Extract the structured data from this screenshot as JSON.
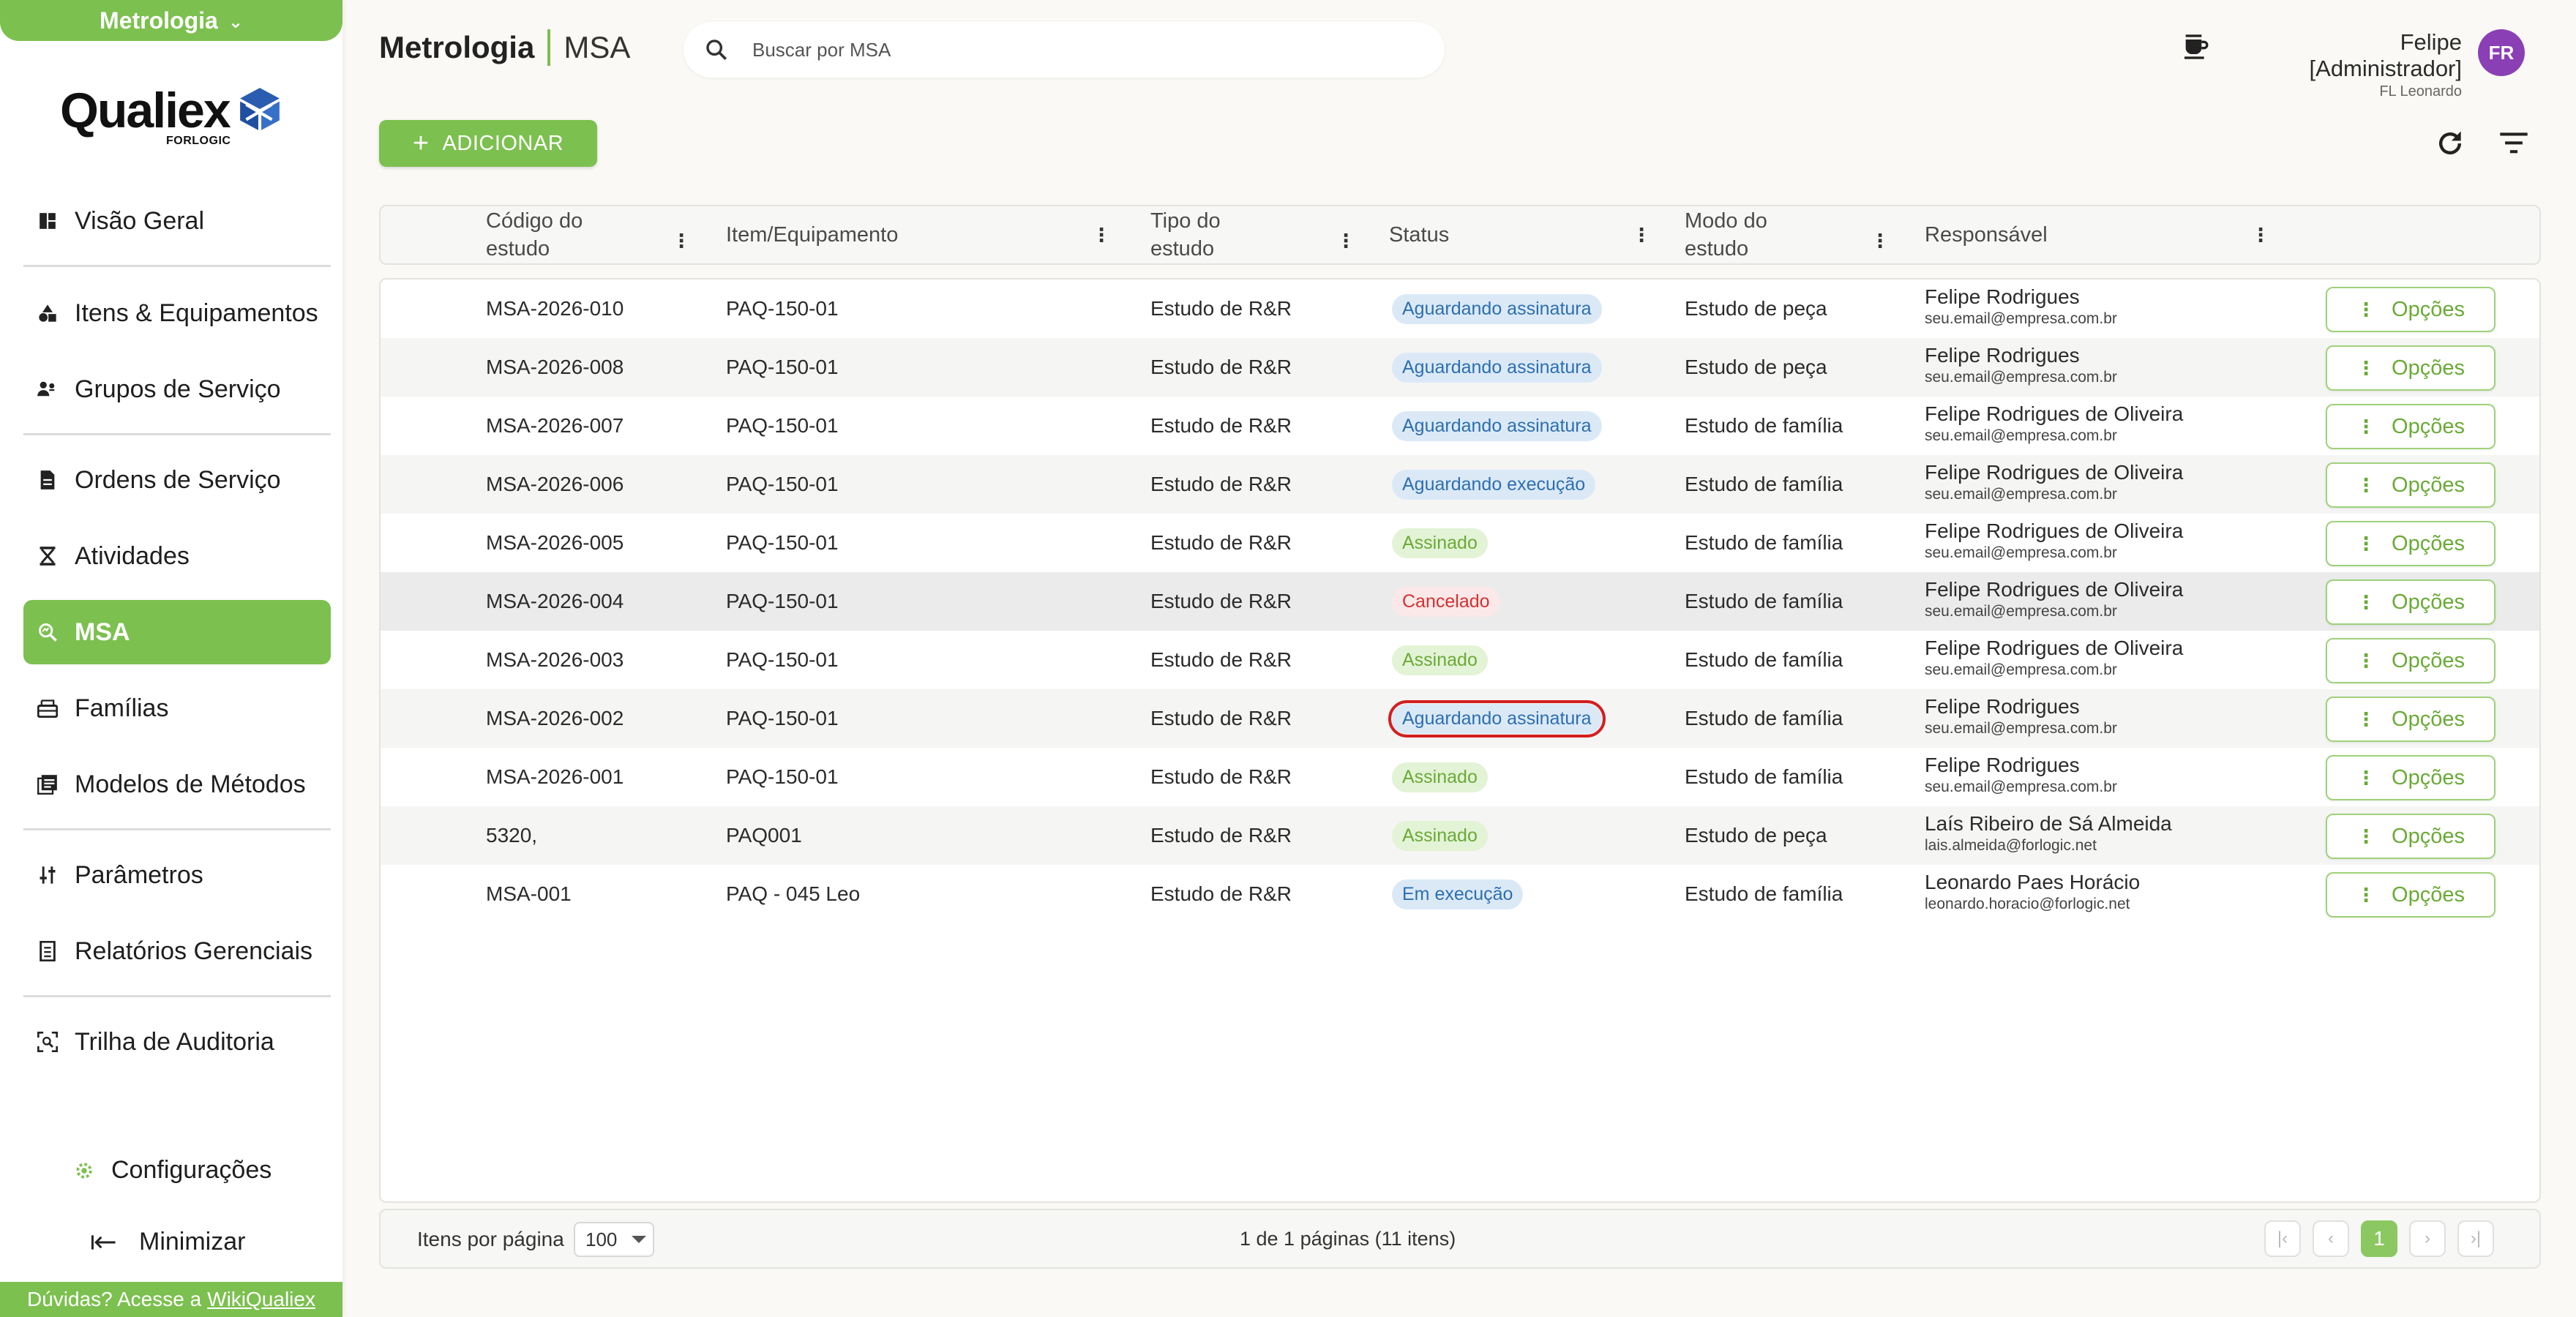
{
  "module": {
    "name": "Metrologia"
  },
  "logo": {
    "word": "Qualiex",
    "sub": "FORLOGIC"
  },
  "nav": {
    "items": [
      {
        "label": "Visão Geral",
        "icon": "dashboard-icon"
      },
      {
        "label": "Itens & Equipamentos",
        "icon": "shapes-icon"
      },
      {
        "label": "Grupos de Serviço",
        "icon": "people-icon"
      },
      {
        "label": "Ordens de Serviço",
        "icon": "document-icon"
      },
      {
        "label": "Atividades",
        "icon": "hourglass-icon"
      },
      {
        "label": "MSA",
        "icon": "magnify-icon",
        "active": true
      },
      {
        "label": "Famílias",
        "icon": "tray-icon"
      },
      {
        "label": "Modelos de Métodos",
        "icon": "library-icon"
      },
      {
        "label": "Parâmetros",
        "icon": "sliders-icon"
      },
      {
        "label": "Relatórios Gerenciais",
        "icon": "report-icon"
      },
      {
        "label": "Trilha de Auditoria",
        "icon": "audit-icon"
      }
    ],
    "settings_label": "Configurações",
    "minimize_label": "Minimizar"
  },
  "help": {
    "text": "Dúvidas? Acesse a",
    "link": "WikiQualiex"
  },
  "header": {
    "title_strong": "Metrologia",
    "title_light": "MSA",
    "search_placeholder": "Buscar por MSA",
    "user_name": "Felipe [Administrador]",
    "user_org": "FL Leonardo",
    "avatar_initials": "FR"
  },
  "toolbar": {
    "add_label": "ADICIONAR"
  },
  "table": {
    "columns": [
      {
        "label": "Código do estudo"
      },
      {
        "label": "Item/Equipamento"
      },
      {
        "label": "Tipo do estudo"
      },
      {
        "label": "Status"
      },
      {
        "label": "Modo do estudo"
      },
      {
        "label": "Responsável"
      }
    ],
    "options_label": "Opções",
    "rows": [
      {
        "code": "MSA-2026-010",
        "item": "PAQ-150-01",
        "type": "Estudo de R&R",
        "status": "Aguardando assinatura",
        "status_color": "blue",
        "mode": "Estudo de peça",
        "resp": "Felipe Rodrigues",
        "email": "seu.email@empresa.com.br"
      },
      {
        "code": "MSA-2026-008",
        "item": "PAQ-150-01",
        "type": "Estudo de R&R",
        "status": "Aguardando assinatura",
        "status_color": "blue",
        "mode": "Estudo de peça",
        "resp": "Felipe Rodrigues",
        "email": "seu.email@empresa.com.br"
      },
      {
        "code": "MSA-2026-007",
        "item": "PAQ-150-01",
        "type": "Estudo de R&R",
        "status": "Aguardando assinatura",
        "status_color": "blue",
        "mode": "Estudo de família",
        "resp": "Felipe Rodrigues de Oliveira",
        "email": "seu.email@empresa.com.br"
      },
      {
        "code": "MSA-2026-006",
        "item": "PAQ-150-01",
        "type": "Estudo de R&R",
        "status": "Aguardando execução",
        "status_color": "blue",
        "mode": "Estudo de família",
        "resp": "Felipe Rodrigues de Oliveira",
        "email": "seu.email@empresa.com.br"
      },
      {
        "code": "MSA-2026-005",
        "item": "PAQ-150-01",
        "type": "Estudo de R&R",
        "status": "Assinado",
        "status_color": "green",
        "mode": "Estudo de família",
        "resp": "Felipe Rodrigues de Oliveira",
        "email": "seu.email@empresa.com.br"
      },
      {
        "code": "MSA-2026-004",
        "item": "PAQ-150-01",
        "type": "Estudo de R&R",
        "status": "Cancelado",
        "status_color": "red",
        "mode": "Estudo de família",
        "resp": "Felipe Rodrigues de Oliveira",
        "email": "seu.email@empresa.com.br"
      },
      {
        "code": "MSA-2026-003",
        "item": "PAQ-150-01",
        "type": "Estudo de R&R",
        "status": "Assinado",
        "status_color": "green",
        "mode": "Estudo de família",
        "resp": "Felipe Rodrigues de Oliveira",
        "email": "seu.email@empresa.com.br"
      },
      {
        "code": "MSA-2026-002",
        "item": "PAQ-150-01",
        "type": "Estudo de R&R",
        "status": "Aguardando assinatura",
        "status_color": "blue",
        "mode": "Estudo de família",
        "resp": "Felipe Rodrigues",
        "email": "seu.email@empresa.com.br"
      },
      {
        "code": "MSA-2026-001",
        "item": "PAQ-150-01",
        "type": "Estudo de R&R",
        "status": "Assinado",
        "status_color": "green",
        "mode": "Estudo de família",
        "resp": "Felipe Rodrigues",
        "email": "seu.email@empresa.com.br"
      },
      {
        "code": "5320,",
        "item": "PAQ001",
        "type": "Estudo de R&R",
        "status": "Assinado",
        "status_color": "green",
        "mode": "Estudo de peça",
        "resp": "Laís Ribeiro de Sá Almeida",
        "email": "lais.almeida@forlogic.net"
      },
      {
        "code": "MSA-001",
        "item": "PAQ - 045 Leo",
        "type": "Estudo de R&R",
        "status": "Em execução",
        "status_color": "blue",
        "mode": "Estudo de família",
        "resp": "Leonardo Paes Horácio",
        "email": "leonardo.horacio@forlogic.net"
      }
    ]
  },
  "footer": {
    "per_page_label": "Itens por página",
    "per_page_value": "100",
    "page_info": "1 de 1 páginas (11 itens)",
    "current_page": "1"
  },
  "colors": {
    "brand": "#7cc04f",
    "avatar": "#8a3fb5",
    "highlight": "#d21f1f"
  }
}
